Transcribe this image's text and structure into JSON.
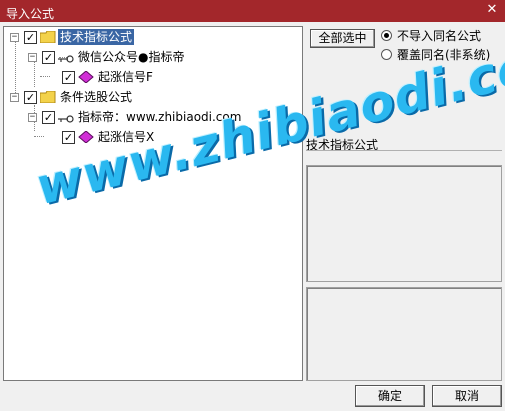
{
  "window": {
    "title": "导入公式",
    "close_glyph": "✕"
  },
  "tree": {
    "nodes": [
      {
        "label": "技术指标公式",
        "checked": true,
        "type": "folder"
      },
      {
        "label": "微信公众号●指标帝",
        "checked": true,
        "type": "key"
      },
      {
        "label": "起涨信号F",
        "checked": true,
        "type": "formula"
      },
      {
        "label": "条件选股公式",
        "checked": true,
        "type": "folder"
      },
      {
        "label": "指标帝：www.zhibiaodi.com",
        "checked": true,
        "type": "key"
      },
      {
        "label": "起涨信号X",
        "checked": true,
        "type": "formula"
      }
    ],
    "check_glyph": "✓",
    "expander_glyph": "−"
  },
  "options": {
    "select_all": "全部选中",
    "radio_skip": "不导入同名公式",
    "radio_overwrite": "覆盖同名(非系统)",
    "selected_radio": "radio_skip"
  },
  "detail": {
    "formula_name": "技术指标公式"
  },
  "buttons": {
    "ok": "确定",
    "cancel": "取消"
  },
  "watermark": "www.zhibiaodi.com",
  "colors": {
    "titlebar": "#a3272b",
    "selection": "#3a66a4",
    "watermark": "#2ab8f0"
  }
}
